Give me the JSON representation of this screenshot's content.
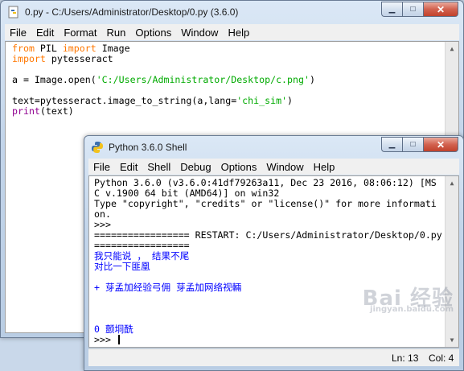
{
  "editor": {
    "title": "0.py - C:/Users/Administrator/Desktop/0.py (3.6.0)",
    "menu": [
      "File",
      "Edit",
      "Format",
      "Run",
      "Options",
      "Window",
      "Help"
    ],
    "code": {
      "l1_kw_from": "from",
      "l1_mod": " PIL ",
      "l1_kw_import": "import",
      "l1_name": " Image",
      "l2_kw_import": "import",
      "l2_name": " pytesseract",
      "l4_pre": "a = Image.open(",
      "l4_str": "'C:/Users/Administrator/Desktop/c.png'",
      "l4_post": ")",
      "l6_pre": "text=pytesseract.image_to_string(a,lang=",
      "l6_str": "'chi_sim'",
      "l6_post": ")",
      "l7_bi": "print",
      "l7_post": "(text)"
    }
  },
  "shell": {
    "title": "Python 3.6.0 Shell",
    "menu": [
      "File",
      "Edit",
      "Shell",
      "Debug",
      "Options",
      "Window",
      "Help"
    ],
    "banner": [
      "Python 3.6.0 (v3.6.0:41df79263a11, Dec 23 2016, 08:06:12) [MS",
      "C v.1900 64 bit (AMD64)] on win32",
      "Type \"copyright\", \"credits\" or \"license()\" for more informati",
      "on."
    ],
    "prompt": ">>>",
    "restart": [
      "================= RESTART: C:/Users/Administrator/Desktop/0.py",
      "================="
    ],
    "output": [
      "我只能说 ， 结果不尾",
      "对比一下匪凰",
      "",
      "+ 芽孟加经验弓佣 芽孟加网络视輛",
      "",
      "",
      "",
      "0 颤垌酰"
    ],
    "final_prompt": ">>> ",
    "status": {
      "line": "Ln: 13",
      "col": "Col: 4"
    }
  },
  "watermark": {
    "text": "Bai 经验",
    "sub": "jingyan.baidu.com"
  }
}
